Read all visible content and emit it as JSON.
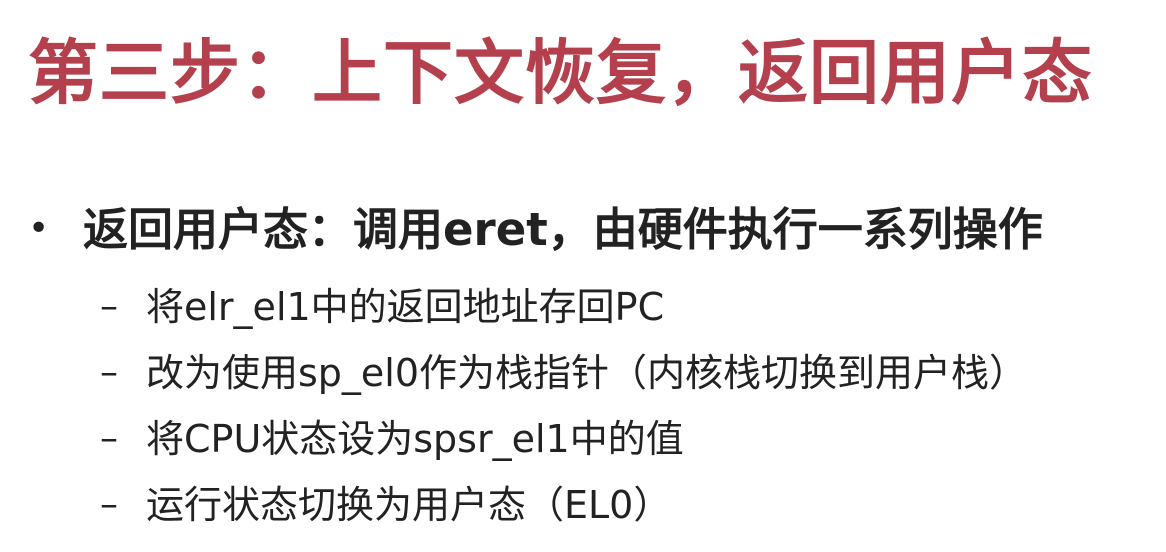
{
  "slide": {
    "title": "第三步：上下文恢复，返回用户态",
    "bullet": {
      "marker": "•",
      "text": "返回用户态：调用eret，由硬件执行一系列操作"
    },
    "sub_items": [
      {
        "marker": "–",
        "text": "将elr_el1中的返回地址存回PC"
      },
      {
        "marker": "–",
        "text": "改为使用sp_el0作为栈指针（内核栈切换到用户栈）"
      },
      {
        "marker": "–",
        "text": "将CPU状态设为spsr_el1中的值"
      },
      {
        "marker": "–",
        "text": "运行状态切换为用户态（EL0）"
      }
    ],
    "colors": {
      "title": "#b5404d",
      "body_text": "#222222",
      "background": "#ffffff"
    }
  }
}
